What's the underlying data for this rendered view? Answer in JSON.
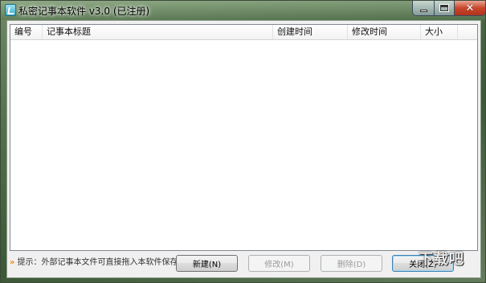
{
  "window": {
    "title": "私密记事本软件 v3.0 (已注册)",
    "minimize_icon": "minimize-icon",
    "maximize_icon": "maximize-icon",
    "close_icon": "close-icon",
    "close_glyph": "✕"
  },
  "list": {
    "columns": [
      {
        "label": "编号"
      },
      {
        "label": "记事本标题"
      },
      {
        "label": "创建时间"
      },
      {
        "label": "修改时间"
      },
      {
        "label": "大小"
      }
    ],
    "rows": []
  },
  "hint": {
    "icon": "»",
    "text": "提示：外部记事本文件可直接拖入本软件保存"
  },
  "buttons": {
    "new": "新建(N)",
    "edit": "修改(M)",
    "delete": "删除(D)",
    "close": "关闭(Z)"
  },
  "watermark": "下载吧"
}
